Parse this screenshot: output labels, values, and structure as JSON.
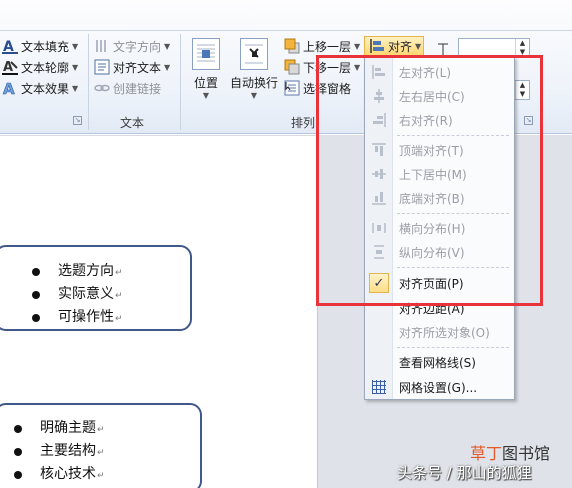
{
  "ribbon": {
    "text_group": {
      "items": [
        {
          "label": "文本填充",
          "icon": "text-fill-icon"
        },
        {
          "label": "文本轮廓",
          "icon": "text-outline-icon"
        },
        {
          "label": "文本效果",
          "icon": "text-effects-icon"
        }
      ],
      "direction_label": "文字方向",
      "align_text_label": "对齐文本",
      "create_link_label": "创建链接",
      "group_label": "文本"
    },
    "arrange_group": {
      "position_label": "位置",
      "wrap_label": "自动换行",
      "bring_forward_label": "上移一层",
      "send_backward_label": "下移一层",
      "selection_pane_label": "选择窗格",
      "align_label": "对齐",
      "group_label": "排列"
    }
  },
  "document": {
    "box1_items": [
      "选题方向",
      "实际意义",
      "可操作性"
    ],
    "box2_items": [
      "明确主题",
      "主要结构",
      "核心技术"
    ],
    "return_mark": "↵"
  },
  "menu": {
    "items": [
      {
        "label": "左对齐(L)",
        "enabled": false,
        "icon": "align-left-icon"
      },
      {
        "label": "左右居中(C)",
        "enabled": false,
        "icon": "align-center-icon"
      },
      {
        "label": "右对齐(R)",
        "enabled": false,
        "icon": "align-right-icon"
      },
      {
        "label": "顶端对齐(T)",
        "enabled": false,
        "icon": "align-top-icon"
      },
      {
        "label": "上下居中(M)",
        "enabled": false,
        "icon": "align-middle-icon"
      },
      {
        "label": "底端对齐(B)",
        "enabled": false,
        "icon": "align-bottom-icon"
      },
      {
        "label": "横向分布(H)",
        "enabled": false,
        "icon": "distribute-horizontal-icon"
      },
      {
        "label": "纵向分布(V)",
        "enabled": false,
        "icon": "distribute-vertical-icon"
      },
      {
        "label": "对齐页面(P)",
        "enabled": true,
        "checked": true,
        "icon": "checkmark-icon"
      },
      {
        "label": "对齐边距(A)",
        "enabled": true,
        "icon": ""
      },
      {
        "label": "对齐所选对象(O)",
        "enabled": false,
        "icon": ""
      },
      {
        "label": "查看网格线(S)",
        "enabled": true,
        "icon": ""
      },
      {
        "label": "网格设置(G)...",
        "enabled": true,
        "icon": "grid-icon"
      }
    ]
  },
  "watermark": {
    "brand_accent": "草丁",
    "brand_rest": "图书馆",
    "byline": "头条号 / 那山的狐狸"
  },
  "colors": {
    "highlight_border": "#e8333a",
    "box_border": "#41598a",
    "selected_button": "#fed772"
  }
}
